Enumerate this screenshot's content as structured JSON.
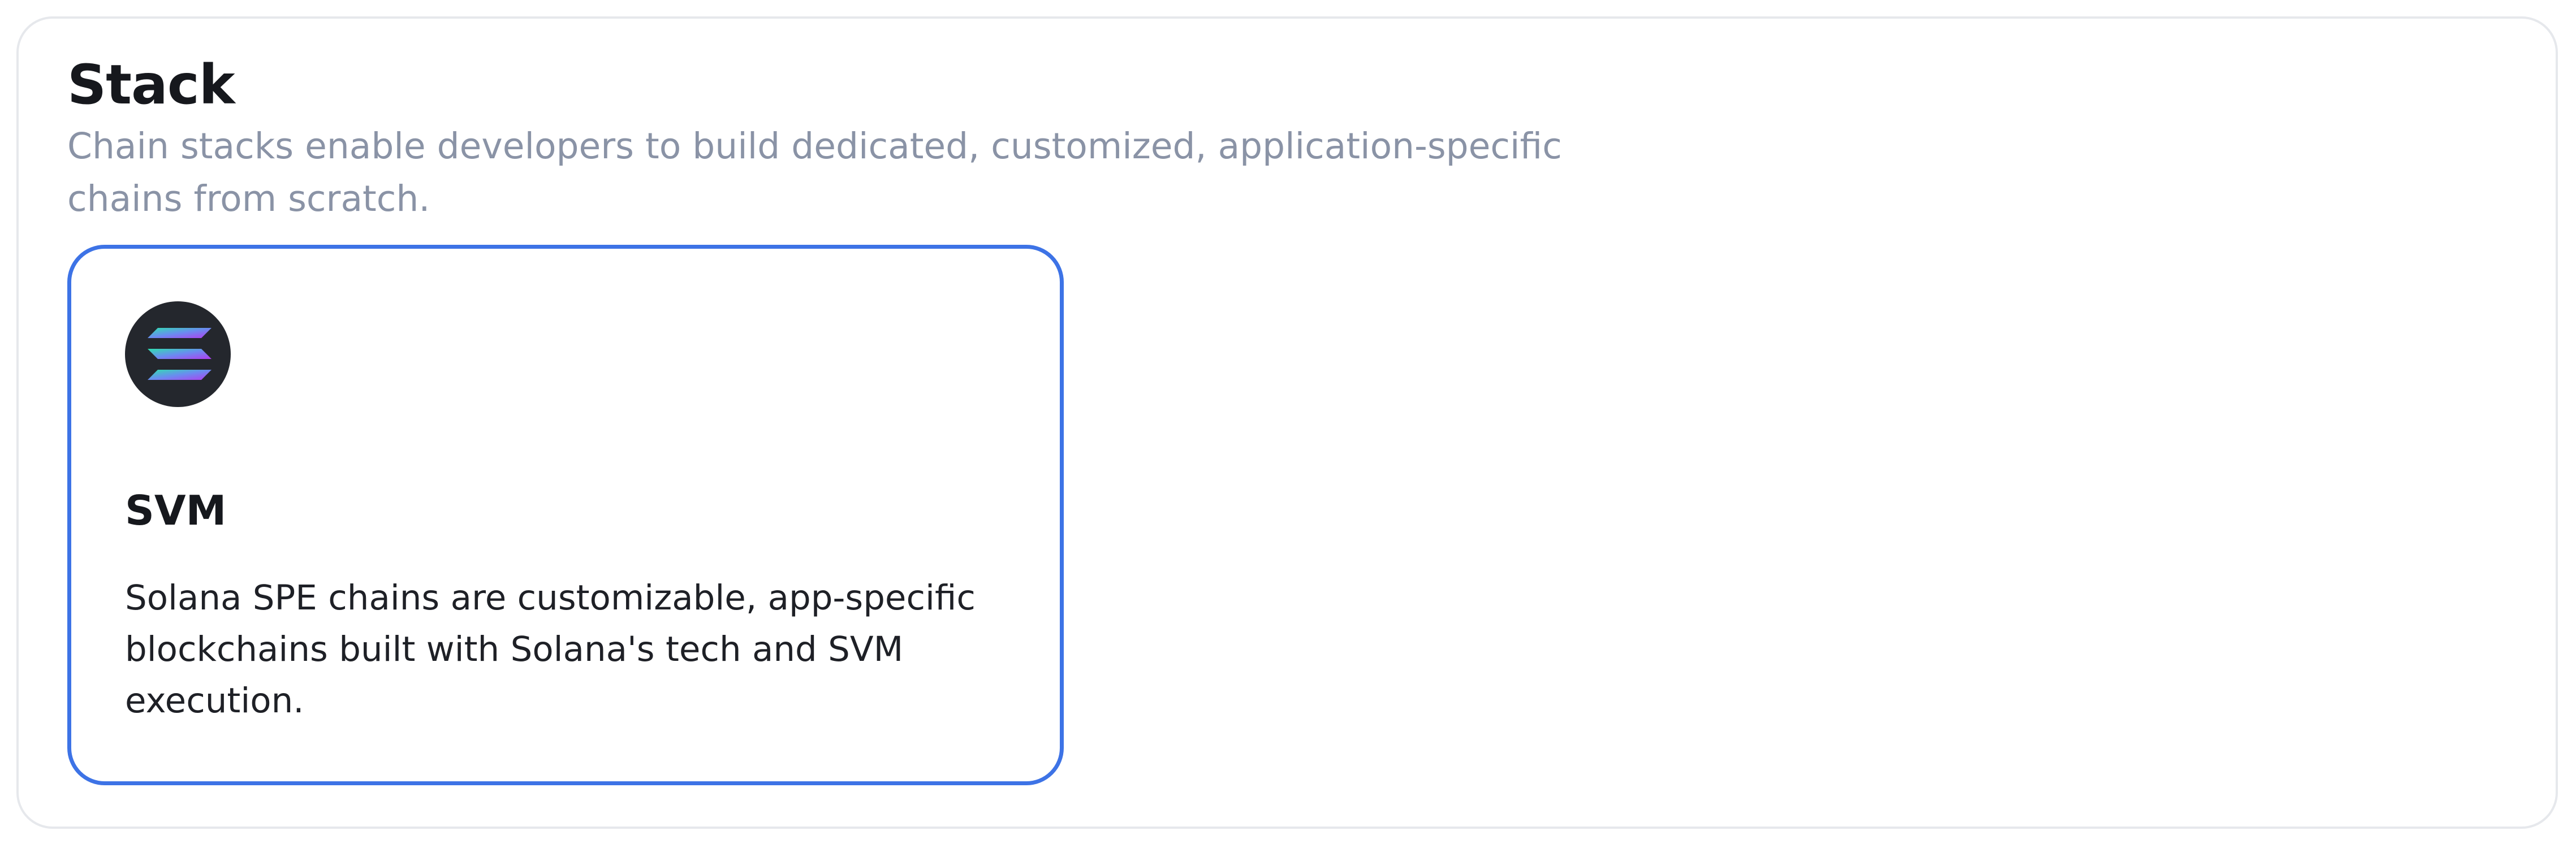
{
  "section": {
    "title": "Stack",
    "description": "Chain stacks enable developers to build dedicated, customized, application-specific chains from scratch."
  },
  "stacks": [
    {
      "icon": "solana-logo-icon",
      "title": "SVM",
      "description": "Solana SPE chains are customizable, app-specific blockchains built with Solana's tech and SVM execution.",
      "selected": true
    }
  ],
  "colors": {
    "selected_border": "#3d73e6",
    "panel_border": "#e6e8ec",
    "subtitle_text": "#8a93a6",
    "logo_background": "#24272d"
  }
}
